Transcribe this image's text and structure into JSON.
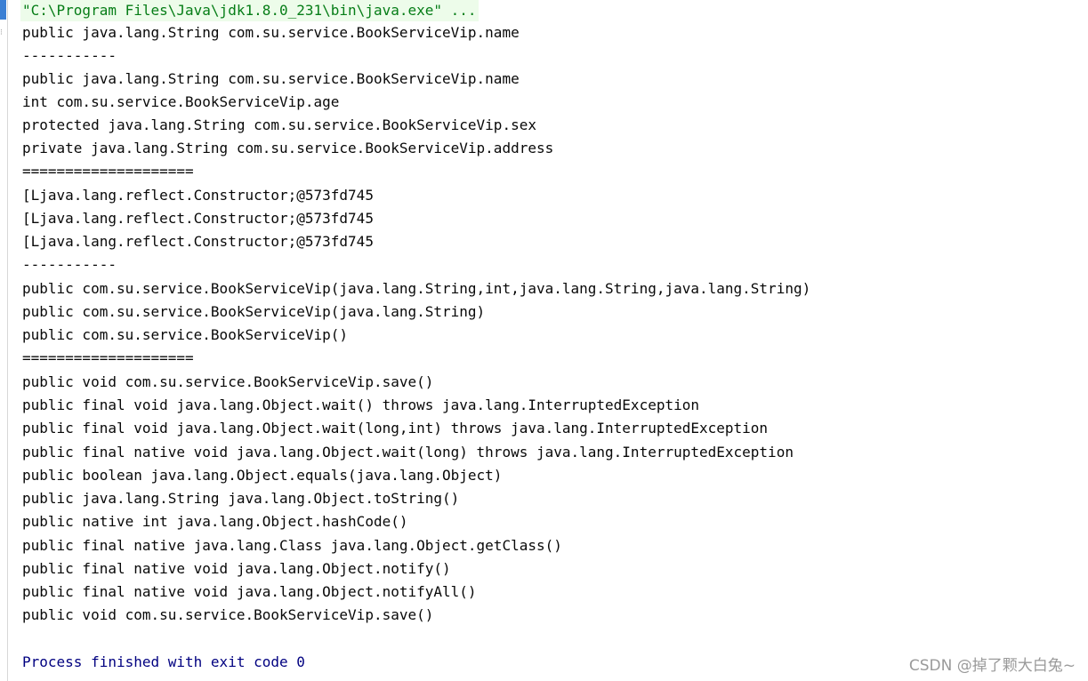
{
  "console": {
    "command": "\"C:\\Program Files\\Java\\jdk1.8.0_231\\bin\\java.exe\" ...",
    "lines": [
      "public java.lang.String com.su.service.BookServiceVip.name",
      "-----------",
      "public java.lang.String com.su.service.BookServiceVip.name",
      "int com.su.service.BookServiceVip.age",
      "protected java.lang.String com.su.service.BookServiceVip.sex",
      "private java.lang.String com.su.service.BookServiceVip.address",
      "====================",
      "[Ljava.lang.reflect.Constructor;@573fd745",
      "[Ljava.lang.reflect.Constructor;@573fd745",
      "[Ljava.lang.reflect.Constructor;@573fd745",
      "-----------",
      "public com.su.service.BookServiceVip(java.lang.String,int,java.lang.String,java.lang.String)",
      "public com.su.service.BookServiceVip(java.lang.String)",
      "public com.su.service.BookServiceVip()",
      "====================",
      "public void com.su.service.BookServiceVip.save()",
      "public final void java.lang.Object.wait() throws java.lang.InterruptedException",
      "public final void java.lang.Object.wait(long,int) throws java.lang.InterruptedException",
      "public final native void java.lang.Object.wait(long) throws java.lang.InterruptedException",
      "public boolean java.lang.Object.equals(java.lang.Object)",
      "public java.lang.String java.lang.Object.toString()",
      "public native int java.lang.Object.hashCode()",
      "public final native java.lang.Class java.lang.Object.getClass()",
      "public final native void java.lang.Object.notify()",
      "public final native void java.lang.Object.notifyAll()",
      "public void com.su.service.BookServiceVip.save()"
    ],
    "exit_message": "Process finished with exit code 0"
  },
  "watermark": "CSDN @掉了颗大白兔~",
  "colors": {
    "command_text": "#067d17",
    "command_background": "#edfcea",
    "output_text": "#080808",
    "exit_text": "#000080",
    "watermark_text": "#9a9a9a",
    "gutter_tab": "#3b7fd4"
  }
}
